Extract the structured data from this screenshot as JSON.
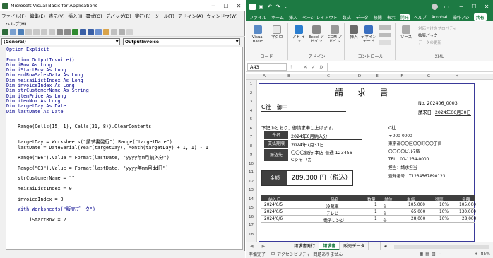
{
  "vba": {
    "title": "Microsoft Visual Basic for Applications",
    "menu": [
      "ファイル(F)",
      "編集(E)",
      "表示(V)",
      "挿入(I)",
      "書式(O)",
      "デバッグ(D)",
      "実行(R)",
      "ツール(T)",
      "アドイン(A)",
      "ウィンドウ(W)"
    ],
    "help": "ヘルプ(H)",
    "object_combo": "(General)",
    "proc_combo": "OutputInvoice",
    "code_lines": [
      "Option Explicit",
      "",
      "Function OutputInvoice()",
      "Dim iRow As Long",
      "Dim iStartRow As Long",
      "Dim endRowSalesData As Long",
      "Dim meisaiListIndex As Long",
      "Dim invoiceIndex As Long",
      "Dim strCustomerName As String",
      "Dim itemPrice As Long",
      "Dim itemNum As Long",
      "Dim targetDay As Date",
      "Dim lastDate As Date",
      "",
      "",
      "    Range(Cells(15, 1), Cells(31, 8)).ClearContents",
      "",
      "",
      "    targetDay = Worksheets(\"請求書発行\").Range(\"targetDate\")",
      "    lastDate = DateSerial(Year(targetDay), Month(targetDay) + 1, 1) - 1",
      "",
      "    Range(\"B6\").Value = Format(lastDate, \"yyyy年m月納入分\")",
      "",
      "    Range(\"G3\").Value = Format(lastDate, \"yyyy年mm月dd日\")",
      "",
      "    strCustomerName = \"\"",
      "",
      "    meisaiListIndex = 0",
      "",
      "    invoiceIndex = 0",
      "",
      "    With Worksheets(\"販売データ\")",
      "",
      "        iStartRow = 2"
    ]
  },
  "excel": {
    "tabs": [
      "ファイル",
      "ホーム",
      "挿入",
      "ページ レイアウト",
      "数式",
      "データ",
      "校閲",
      "表示",
      "開発",
      "ヘルプ",
      "Acrobat",
      "操作アシ"
    ],
    "active_tab": "開発",
    "share_label": "共有",
    "ribbon": {
      "code_group": "コード",
      "code_buttons": [
        "Visual Basic",
        "マクロ"
      ],
      "addin_group": "アドイン",
      "addin_buttons": [
        "アド イン",
        "Excel アドイン",
        "COM アドイン"
      ],
      "control_group": "コントロール",
      "control_buttons": [
        "挿入",
        "デザイン モード"
      ],
      "control_small": [
        "プロパティ",
        "コードの表示",
        "ダイアログの実行"
      ],
      "xml_group": "XML",
      "xml_items": [
        "ソース",
        "対応付けのプロパティ",
        "拡張パック",
        "データの更新"
      ]
    },
    "name_box": "A43",
    "fx": "fx",
    "columns": [
      "A",
      "B",
      "C",
      "D",
      "E",
      "F",
      "G",
      "H"
    ],
    "rows": [
      "1",
      "2",
      "3",
      "4",
      "5",
      "6",
      "7",
      "8",
      "9",
      "10",
      "11",
      "12",
      "13",
      "14",
      "15",
      "16",
      "17",
      "18"
    ],
    "invoice": {
      "title": "請 求 書",
      "no_label": "No.",
      "no_value": "202406_0003",
      "issue_label": "請求日",
      "issue_value": "2024年06月30日",
      "customer": "C社　御中",
      "intro": "下記のとおり、御請求申し上げます。",
      "rows": [
        {
          "label": "件名",
          "value": "2024年6月納入分"
        },
        {
          "label": "支払期限",
          "value": "2024年7月31日"
        },
        {
          "label": "振込先",
          "value": "〇〇〇銀行 本店 普通 123456"
        },
        {
          "label": "",
          "value": "Cシャ（カ"
        }
      ],
      "seller": [
        "C社",
        "〒000-0000",
        "東京都〇〇区〇〇町〇〇丁目",
        "〇〇〇〇ビル7階",
        "TEL：00-1234-0000",
        "担当：請求担当",
        "登録番号：T1234567890123"
      ],
      "total_label": "金額",
      "total_value": "289,300 円（税込）",
      "table_headers": [
        "納入日",
        "品名",
        "数量",
        "単位",
        "単価",
        "税率",
        "金額"
      ],
      "items": [
        {
          "date": "2024/6/5",
          "name": "冷蔵庫",
          "qty": "1",
          "unit": "台",
          "price": "105,000",
          "tax": "10%",
          "amount": "105,000"
        },
        {
          "date": "2024/6/5",
          "name": "テレビ",
          "qty": "1",
          "unit": "台",
          "price": "65,000",
          "tax": "10%",
          "amount": "130,000"
        },
        {
          "date": "2024/6/6",
          "name": "電子レンジ",
          "qty": "1",
          "unit": "台",
          "price": "28,000",
          "tax": "10%",
          "amount": "28,000"
        }
      ]
    },
    "sheet_tabs": [
      "請求書発行",
      "請求書",
      "販売データ",
      "..."
    ],
    "active_sheet": "請求書",
    "status": [
      "準備完了",
      "アクセシビリティ: 問題ありません"
    ],
    "zoom": "85%"
  }
}
